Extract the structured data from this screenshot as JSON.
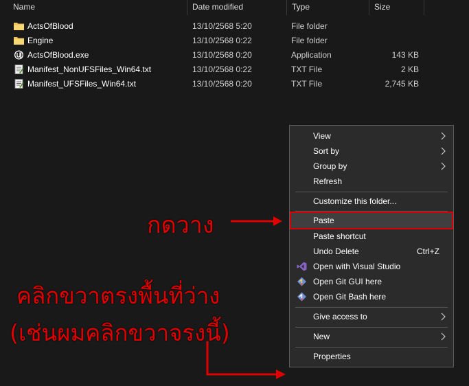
{
  "columns": {
    "name": "Name",
    "date": "Date modified",
    "type": "Type",
    "size": "Size"
  },
  "files": [
    {
      "icon": "folder-icon",
      "name": "ActsOfBlood",
      "date": "13/10/2568 5:20",
      "type": "File folder",
      "size": ""
    },
    {
      "icon": "folder-icon",
      "name": "Engine",
      "date": "13/10/2568 0:22",
      "type": "File folder",
      "size": ""
    },
    {
      "icon": "unreal-app-icon",
      "name": "ActsOfBlood.exe",
      "date": "13/10/2568 0:20",
      "type": "Application",
      "size": "143 KB"
    },
    {
      "icon": "text-file-icon",
      "name": "Manifest_NonUFSFiles_Win64.txt",
      "date": "13/10/2568 0:22",
      "type": "TXT File",
      "size": "2 KB"
    },
    {
      "icon": "text-file-icon",
      "name": "Manifest_UFSFiles_Win64.txt",
      "date": "13/10/2568 0:20",
      "type": "TXT File",
      "size": "2,745 KB"
    }
  ],
  "menu": {
    "view": "View",
    "sort_by": "Sort by",
    "group_by": "Group by",
    "refresh": "Refresh",
    "customize": "Customize this folder...",
    "paste": "Paste",
    "paste_shortcut": "Paste shortcut",
    "undo_delete": "Undo Delete",
    "undo_shortcut": "Ctrl+Z",
    "open_vs": "Open with Visual Studio",
    "open_git_gui": "Open Git GUI here",
    "open_git_bash": "Open Git Bash here",
    "give_access": "Give access to",
    "new": "New",
    "properties": "Properties"
  },
  "annotations": {
    "paste_note": "กดวาง",
    "click_line1": "คลิกขวาตรงพื้นที่ว่าง",
    "click_line2": "(เช่นผมคลิกขวาจรงนี้)"
  },
  "colors": {
    "annotation": "#e00000",
    "folder": "#f2c55c",
    "background": "#191919",
    "menu": "#2b2b2b"
  }
}
